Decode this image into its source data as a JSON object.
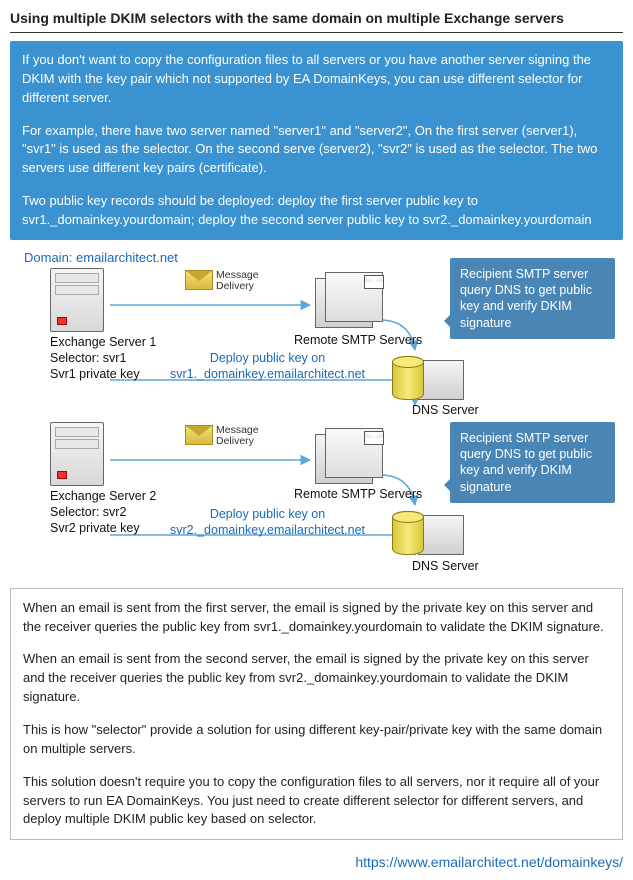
{
  "title": "Using multiple DKIM selectors with the same domain on multiple Exchange servers",
  "intro": {
    "p1": "If you don't want to copy the configuration files to all servers or you have another server signing the DKIM with the key pair which not supported by EA DomainKeys, you can use different selector for different server.",
    "p2": "For example, there have two server named \"server1\" and \"server2\", On the first server (server1), \"svr1\" is used as the selector. On the second serve (server2), \"svr2\" is used as the selector. The two servers use different key pairs (certificate).",
    "p3": "Two public key records should be deployed: deploy the first server public key to svr1._domainkey.yourdomain; deploy the second server public key to svr2._domainkey.yourdomain"
  },
  "diagram": {
    "domain": "Domain: emailarchitect.net",
    "server1": {
      "name": "Exchange Server 1",
      "sel": "Selector: svr1",
      "key": "Svr1 private key"
    },
    "server2": {
      "name": "Exchange Server 2",
      "sel": "Selector: svr2",
      "key": "Svr2 private key"
    },
    "smtp": "Remote SMTP Servers",
    "smtp2": "Remote SMTP Servers",
    "dns": "DNS Server",
    "dns2": "DNS Server",
    "msg": "Message\nDelivery",
    "deploy1a": "Deploy public key on",
    "deploy1b": "svr1._domainkey.emailarchitect.net",
    "deploy2a": "Deploy public key on",
    "deploy2b": "svr2._domainkey.emailarchitect.net",
    "callout": "Recipient SMTP server query DNS to get public key and verify DKIM signature"
  },
  "bottom": {
    "p1": "When an email is sent from the first server, the email is signed by the private key on this server and the receiver queries the public key from svr1._domainkey.yourdomain to validate the DKIM signature.",
    "p2": "When an email is sent from the second server, the email is signed by the private key on this server and the receiver queries the public key from svr2._domainkey.yourdomain to validate the DKIM signature.",
    "p3": "This is how \"selector\" provide a solution for using different key-pair/private key with the same domain on multiple servers.",
    "p4": "This solution doesn't require you to copy the configuration files to all servers, nor it require all of your servers to run EA DomainKeys. You just need to create different selector for different servers, and deploy multiple DKIM public key based on selector."
  },
  "footer": "https://www.emailarchitect.net/domainkeys/"
}
